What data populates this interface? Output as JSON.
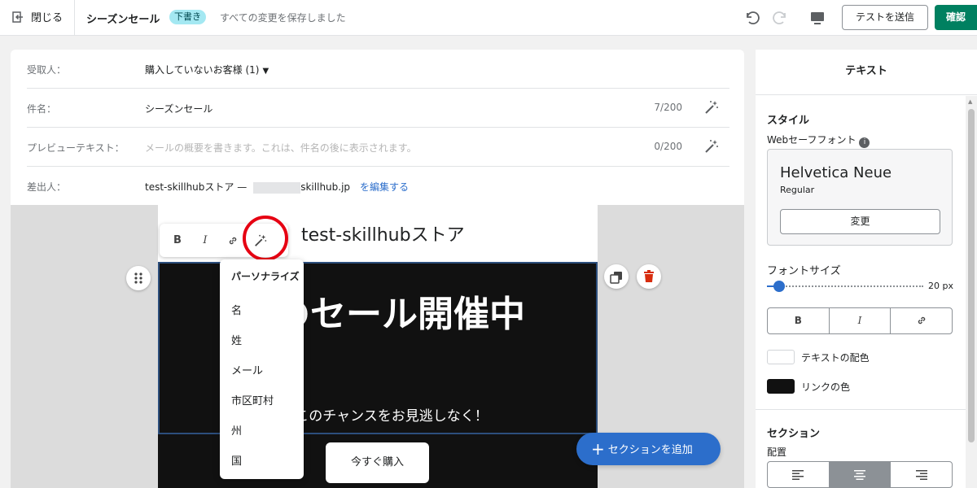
{
  "topbar": {
    "close_label": "閉じる",
    "title": "シーズンセール",
    "badge": "下書き",
    "saved_status": "すべての変更を保存しました",
    "send_test_label": "テストを送信",
    "confirm_label": "確認"
  },
  "fields": {
    "recipient": {
      "label": "受取人：",
      "value": "購入していないお客様 (1)"
    },
    "subject": {
      "label": "件名：",
      "value": "シーズンセール",
      "counter": "7/200"
    },
    "preview": {
      "label": "プレビューテキスト：",
      "placeholder": "メールの概要を書きます。これは、件名の後に表示されます。",
      "counter": "0/200"
    },
    "sender": {
      "label": "差出人：",
      "name": "test-skillhubストア —",
      "domain": "skillhub.jp",
      "edit_link": "を編集する"
    }
  },
  "email": {
    "store_name": "test-skillhubストア",
    "hero_title": "冬のセール開催中",
    "hero_subtitle": "様、このチャンスをお見逃しなく！",
    "buy_button": "今すぐ購入"
  },
  "toolbar": {
    "bold": "B",
    "italic": "I"
  },
  "personalize_menu": {
    "heading": "パーソナライズ",
    "items": [
      "名",
      "姓",
      "メール",
      "市区町村",
      "州",
      "国"
    ]
  },
  "add_section_label": "セクションを追加",
  "side_panel": {
    "title": "テキスト",
    "style_heading": "スタイル",
    "web_safe_font_label": "Webセーフフォント",
    "font_name": "Helvetica Neue",
    "font_weight": "Regular",
    "change_button": "変更",
    "font_size_label": "フォントサイズ",
    "font_size_value": "20 px",
    "font_size": 20,
    "fmt_bold": "B",
    "fmt_italic": "I",
    "text_color_label": "テキストの配色",
    "text_color": "#ffffff",
    "link_color_label": "リンクの色",
    "link_color": "#111111",
    "section_heading": "セクション",
    "alignment_label": "配置",
    "alignment_selected": "center"
  },
  "colors": {
    "primary": "#008060",
    "accent_blue": "#2c6ecb",
    "badge_bg": "#a4e8f2",
    "highlight_ring": "#e60012",
    "hero_bg": "#111111"
  }
}
